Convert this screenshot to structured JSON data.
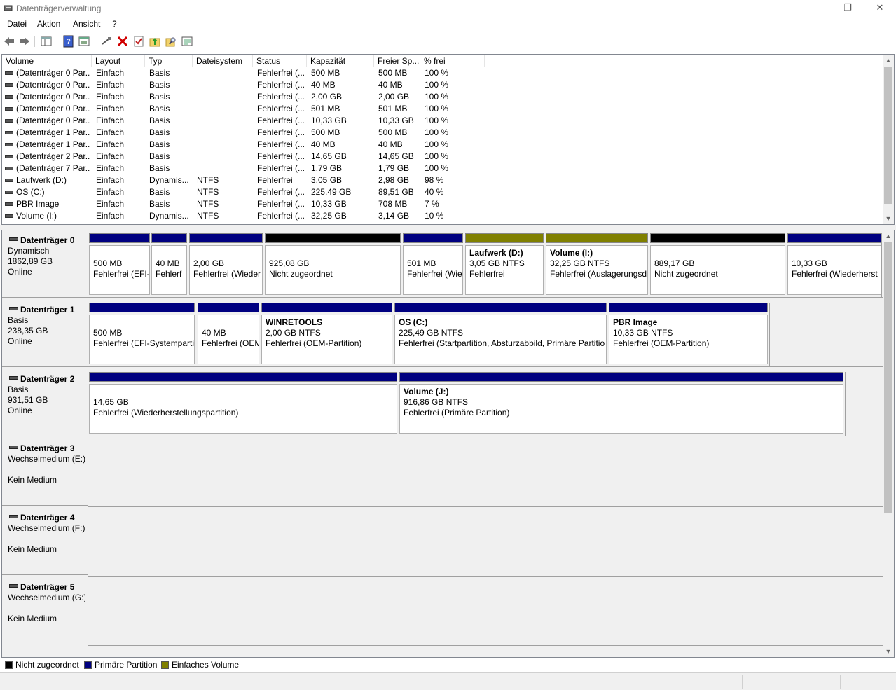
{
  "window": {
    "title": "Datenträgerverwaltung",
    "minimize": "—",
    "restore": "❐",
    "close": "✕"
  },
  "menu": [
    "Datei",
    "Aktion",
    "Ansicht",
    "?"
  ],
  "toolbar": {
    "icons": [
      "back-arrow-icon",
      "forward-arrow-icon",
      "console-tree-icon",
      "help-icon",
      "properties-icon",
      "connect-icon",
      "delete-icon",
      "check-icon",
      "folder-up-icon",
      "folder-search-icon",
      "settings-panel-icon"
    ]
  },
  "volume_list": {
    "columns": [
      "Volume",
      "Layout",
      "Typ",
      "Dateisystem",
      "Status",
      "Kapazität",
      "Freier Sp...",
      "% frei"
    ],
    "rows": [
      [
        "(Datenträger 0 Par...",
        "Einfach",
        "Basis",
        "",
        "Fehlerfrei (...",
        "500 MB",
        "500 MB",
        "100 %"
      ],
      [
        "(Datenträger 0 Par...",
        "Einfach",
        "Basis",
        "",
        "Fehlerfrei (...",
        "40 MB",
        "40 MB",
        "100 %"
      ],
      [
        "(Datenträger 0 Par...",
        "Einfach",
        "Basis",
        "",
        "Fehlerfrei (...",
        "2,00 GB",
        "2,00 GB",
        "100 %"
      ],
      [
        "(Datenträger 0 Par...",
        "Einfach",
        "Basis",
        "",
        "Fehlerfrei (...",
        "501 MB",
        "501 MB",
        "100 %"
      ],
      [
        "(Datenträger 0 Par...",
        "Einfach",
        "Basis",
        "",
        "Fehlerfrei (...",
        "10,33 GB",
        "10,33 GB",
        "100 %"
      ],
      [
        "(Datenträger 1 Par...",
        "Einfach",
        "Basis",
        "",
        "Fehlerfrei (...",
        "500 MB",
        "500 MB",
        "100 %"
      ],
      [
        "(Datenträger 1 Par...",
        "Einfach",
        "Basis",
        "",
        "Fehlerfrei (...",
        "40 MB",
        "40 MB",
        "100 %"
      ],
      [
        "(Datenträger 2 Par...",
        "Einfach",
        "Basis",
        "",
        "Fehlerfrei (...",
        "14,65 GB",
        "14,65 GB",
        "100 %"
      ],
      [
        "(Datenträger 7 Par...",
        "Einfach",
        "Basis",
        "",
        "Fehlerfrei (...",
        "1,79 GB",
        "1,79 GB",
        "100 %"
      ],
      [
        "Laufwerk (D:)",
        "Einfach",
        "Dynamis...",
        "NTFS",
        "Fehlerfrei",
        "3,05 GB",
        "2,98 GB",
        "98 %"
      ],
      [
        "OS (C:)",
        "Einfach",
        "Basis",
        "NTFS",
        "Fehlerfrei (...",
        "225,49 GB",
        "89,51 GB",
        "40 %"
      ],
      [
        "PBR Image",
        "Einfach",
        "Basis",
        "NTFS",
        "Fehlerfrei (...",
        "10,33 GB",
        "708 MB",
        "7 %"
      ],
      [
        "Volume (I:)",
        "Einfach",
        "Dynamis...",
        "NTFS",
        "Fehlerfrei (...",
        "32,25 GB",
        "3,14 GB",
        "10 %"
      ]
    ]
  },
  "disks": [
    {
      "name": "Datenträger 0",
      "lines": [
        "Dynamisch",
        "1862,89 GB",
        "Online"
      ],
      "partitions": [
        {
          "kind": "primary",
          "name": "",
          "l1": "500 MB",
          "l2": "Fehlerfrei (EFI-"
        },
        {
          "kind": "primary",
          "name": "",
          "l1": "40 MB",
          "l2": "Fehlerf"
        },
        {
          "kind": "primary",
          "name": "",
          "l1": "2,00 GB",
          "l2": "Fehlerfrei (Wieder"
        },
        {
          "kind": "unallocated",
          "name": "",
          "l1": "925,08 GB",
          "l2": "Nicht zugeordnet"
        },
        {
          "kind": "primary",
          "name": "",
          "l1": "501 MB",
          "l2": "Fehlerfrei (Wie"
        },
        {
          "kind": "simple",
          "name": "Laufwerk  (D:)",
          "l1": "3,05 GB NTFS",
          "l2": "Fehlerfrei"
        },
        {
          "kind": "simple",
          "name": "Volume  (I:)",
          "l1": "32,25 GB NTFS",
          "l2": "Fehlerfrei (Auslagerungsd"
        },
        {
          "kind": "unallocated",
          "name": "",
          "l1": "889,17 GB",
          "l2": "Nicht zugeordnet"
        },
        {
          "kind": "primary",
          "name": "",
          "l1": "10,33 GB",
          "l2": "Fehlerfrei (Wiederherst"
        }
      ]
    },
    {
      "name": "Datenträger 1",
      "lines": [
        "Basis",
        "238,35 GB",
        "Online"
      ],
      "partitions": [
        {
          "kind": "primary",
          "name": "",
          "l1": "500 MB",
          "l2": "Fehlerfrei (EFI-Systemparti"
        },
        {
          "kind": "primary",
          "name": "",
          "l1": "40 MB",
          "l2": "Fehlerfrei (OEM"
        },
        {
          "kind": "primary",
          "name": "WINRETOOLS",
          "l1": "2,00 GB NTFS",
          "l2": "Fehlerfrei (OEM-Partition)"
        },
        {
          "kind": "primary",
          "name": "OS  (C:)",
          "l1": "225,49 GB NTFS",
          "l2": "Fehlerfrei (Startpartition, Absturzabbild, Primäre Partitio"
        },
        {
          "kind": "primary",
          "name": "PBR Image",
          "l1": "10,33 GB NTFS",
          "l2": "Fehlerfrei (OEM-Partition)"
        }
      ]
    },
    {
      "name": "Datenträger 2",
      "lines": [
        "Basis",
        "931,51 GB",
        "Online"
      ],
      "partitions": [
        {
          "kind": "primary",
          "name": "",
          "l1": "14,65 GB",
          "l2": "Fehlerfrei (Wiederherstellungspartition)"
        },
        {
          "kind": "primary",
          "name": "Volume  (J:)",
          "l1": "916,86 GB NTFS",
          "l2": "Fehlerfrei (Primäre Partition)"
        }
      ]
    },
    {
      "name": "Datenträger 3",
      "lines": [
        "Wechselmedium (E:)",
        "",
        "Kein Medium"
      ],
      "partitions": []
    },
    {
      "name": "Datenträger 4",
      "lines": [
        "Wechselmedium (F:)",
        "",
        "Kein Medium"
      ],
      "partitions": []
    },
    {
      "name": "Datenträger 5",
      "lines": [
        "Wechselmedium (G:)",
        "",
        "Kein Medium"
      ],
      "partitions": []
    }
  ],
  "legend": [
    {
      "label": "Nicht zugeordnet",
      "color": "#000000"
    },
    {
      "label": "Primäre Partition",
      "color": "#000080"
    },
    {
      "label": "Einfaches Volume",
      "color": "#808000"
    }
  ],
  "colors": {
    "unallocated": "#000000",
    "primary": "#000080",
    "simple": "#808000"
  }
}
